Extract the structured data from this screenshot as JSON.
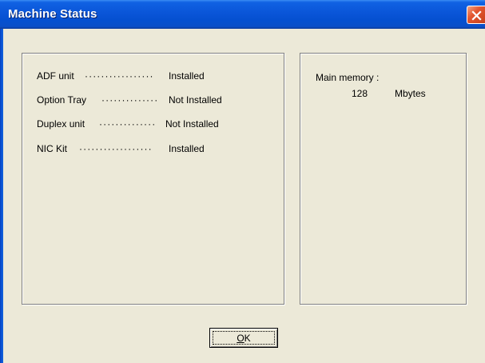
{
  "window": {
    "title": "Machine Status",
    "close_icon": "close-icon"
  },
  "options": {
    "items": [
      {
        "label": "ADF unit",
        "dots": "·················",
        "value": "Installed"
      },
      {
        "label": "Option Tray",
        "dots": "··············",
        "value": "Not Installed"
      },
      {
        "label": "Duplex unit",
        "dots": "··············",
        "value": "Not Installed"
      },
      {
        "label": "NIC Kit",
        "dots": "··················",
        "value": "Installed"
      }
    ]
  },
  "memory": {
    "label": "Main memory :",
    "value": "128",
    "unit": "Mbytes"
  },
  "buttons": {
    "ok_mnemonic": "O",
    "ok_rest": "K"
  },
  "colors": {
    "titlebar": "#0a55d8",
    "dialog_bg": "#ece9d8",
    "close_button": "#e3562f"
  }
}
